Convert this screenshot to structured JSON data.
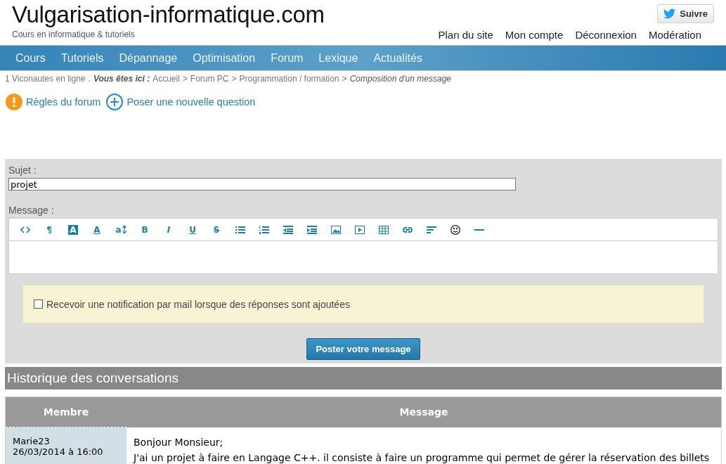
{
  "header": {
    "site_title": "Vulgarisation-informatique.com",
    "tagline": "Cours en informatique & tutoriels",
    "follow_button": "Suivre",
    "top_links": [
      "Plan du site",
      "Mon compte",
      "Déconnexion",
      "Modération"
    ]
  },
  "nav": [
    "Cours",
    "Tutoriels",
    "Dépannage",
    "Optimisation",
    "Forum",
    "Lexique",
    "Actualités"
  ],
  "breadcrumb": {
    "online": "1 Viconautes en ligne",
    "separator": ".",
    "here": "Vous êtes ici :",
    "items": [
      "Accueil",
      "Forum PC",
      "Programmation / formation"
    ],
    "current": "Composition d'un message",
    "arrow": ">"
  },
  "actions": [
    {
      "kind": "warning",
      "label": "Règles du forum"
    },
    {
      "kind": "add",
      "label": "Poser une nouvelle question"
    }
  ],
  "form": {
    "subject_label": "Sujet :",
    "subject_value": "projet",
    "message_label": "Message :",
    "toolbar": [
      {
        "kind": "code"
      },
      {
        "kind": "glyph",
        "label": "¶"
      },
      {
        "kind": "inverted",
        "label": "A"
      },
      {
        "kind": "underlined",
        "label": "A"
      },
      {
        "kind": "size",
        "label": "a"
      },
      {
        "kind": "glyph",
        "label": "B"
      },
      {
        "kind": "italic",
        "label": "I"
      },
      {
        "kind": "underlined",
        "label": "U"
      },
      {
        "kind": "strike",
        "label": "S"
      },
      {
        "kind": "bullets"
      },
      {
        "kind": "numbers"
      },
      {
        "kind": "outdent"
      },
      {
        "kind": "indent"
      },
      {
        "kind": "image"
      },
      {
        "kind": "video"
      },
      {
        "kind": "table"
      },
      {
        "kind": "link"
      },
      {
        "kind": "align"
      },
      {
        "kind": "smiley"
      },
      {
        "kind": "rule"
      }
    ],
    "notify": {
      "label": "Recevoir une notification par mail lorsque des réponses sont ajoutées",
      "checked": false
    },
    "submit": "Poster votre message"
  },
  "history": {
    "title": "Historique des conversations",
    "columns": [
      "Membre",
      "Message"
    ],
    "rows": [
      {
        "member": "Marie23",
        "date": "26/03/2014 à 16:00",
        "lines": [
          "Bonjour Monsieur;",
          "J'ai un projet à faire en Langage C++. il consiste à faire un programme qui permet de gérer la réservation des billets"
        ]
      }
    ]
  }
}
